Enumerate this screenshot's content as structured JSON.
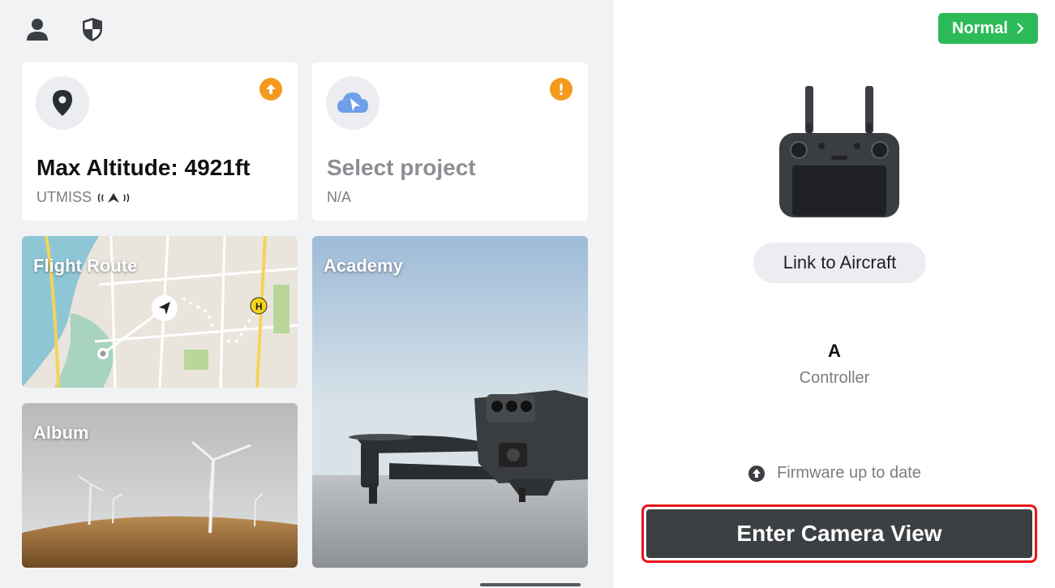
{
  "top_icons": [
    "user-icon",
    "shield-icon"
  ],
  "altitude_card": {
    "title": "Max Altitude: 4921ft",
    "subtitle": "UTMISS",
    "icon": "location-pin-icon",
    "badge_icon": "update-arrow-icon"
  },
  "project_card": {
    "title": "Select project",
    "subtitle": "N/A",
    "icon": "cloud-cursor-icon",
    "badge_icon": "warning-exclamation-icon"
  },
  "tiles": {
    "flight_route": "Flight Route",
    "academy": "Academy",
    "album": "Album"
  },
  "right_panel": {
    "mode_label": "Normal",
    "link_button": "Link to Aircraft",
    "controller_letter": "A",
    "controller_label": "Controller",
    "firmware_status": "Firmware up to date",
    "enter_button": "Enter Camera View"
  },
  "colors": {
    "accent_green": "#2dbb5a",
    "badge_orange": "#f39a1d",
    "highlight_red": "#e8141b",
    "enter_button_bg": "#3d4043"
  }
}
